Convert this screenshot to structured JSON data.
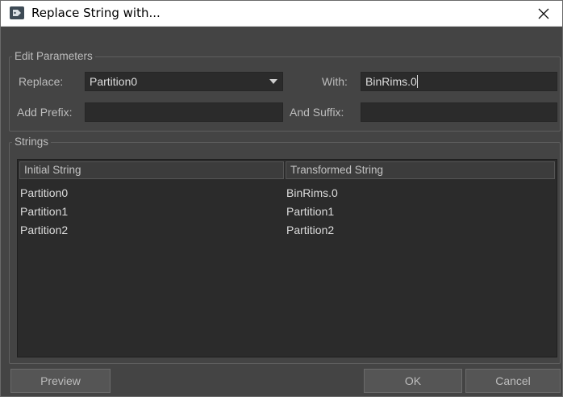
{
  "window": {
    "title": "Replace String with...",
    "close_icon": "close-icon",
    "app_icon": "tag-icon"
  },
  "edit_params": {
    "legend": "Edit Parameters",
    "replace_label": "Replace:",
    "replace_value": "Partition0",
    "with_label": "With:",
    "with_value": "BinRims.0",
    "prefix_label": "Add Prefix:",
    "prefix_value": "",
    "suffix_label": "And Suffix:",
    "suffix_value": ""
  },
  "strings": {
    "legend": "Strings",
    "columns": [
      "Initial String",
      "Transformed String"
    ],
    "rows": [
      [
        "Partition0",
        "BinRims.0"
      ],
      [
        "Partition1",
        "Partition1"
      ],
      [
        "Partition2",
        "Partition2"
      ]
    ]
  },
  "buttons": {
    "preview": "Preview",
    "ok": "OK",
    "cancel": "Cancel"
  },
  "colors": {
    "background": "#444444",
    "field": "#2b2b2b",
    "titlebar": "#ffffff"
  }
}
